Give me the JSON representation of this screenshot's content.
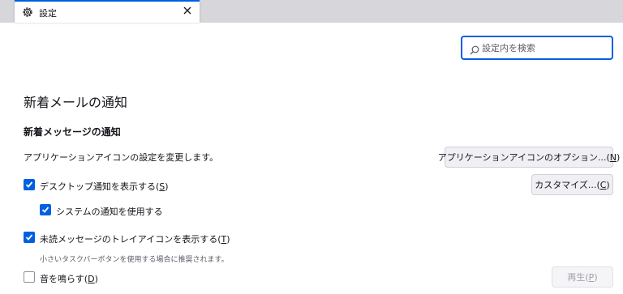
{
  "tab": {
    "title": "設定",
    "icon": "gear-icon",
    "close_icon": "close-icon"
  },
  "search": {
    "placeholder": "設定内を検索",
    "value": ""
  },
  "section": {
    "title": "新着メールの通知"
  },
  "new_message": {
    "heading": "新着メッセージの通知",
    "app_icon_text": "アプリケーションアイコンの設定を変更します。",
    "app_icon_button": {
      "label": "アプリケーションアイコンのオプション...",
      "accesskey": "N"
    },
    "desktop_notify": {
      "label": "デスクトップ通知を表示する",
      "accesskey": "S",
      "checked": true
    },
    "customize_button": {
      "label": "カスタマイズ...",
      "accesskey": "C"
    },
    "system_notify": {
      "label": "システムの通知を使用する",
      "checked": true
    },
    "tray_icon": {
      "label": "未読メッセージのトレイアイコンを表示する",
      "accesskey": "T",
      "checked": true
    },
    "tray_hint": "小さいタスクバーボタンを使用する場合に推奨されます。",
    "play_sound": {
      "label": "音を鳴らす",
      "accesskey": "D",
      "checked": false
    },
    "play_button": {
      "label": "再生",
      "accesskey": "P",
      "disabled": true
    }
  },
  "colors": {
    "accent": "#0060df",
    "tabbar": "#d7d7db"
  }
}
